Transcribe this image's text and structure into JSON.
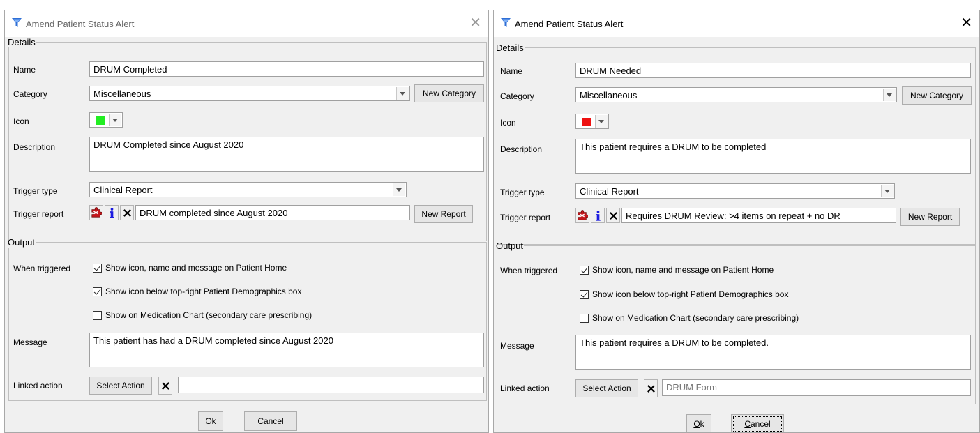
{
  "colors": {
    "left_icon": "#22ee22",
    "right_icon": "#ee1111",
    "info_icon": "#1a1ae0"
  },
  "icons": {
    "app": "filter-funnel-icon",
    "close": "close-icon",
    "trigger": "report-puzzle-icon",
    "info": "info-icon",
    "clear": "clear-x-icon"
  },
  "left": {
    "title": "Amend Patient Status Alert",
    "close": "✕",
    "details": {
      "legend": "Details",
      "name_label": "Name",
      "name_value": "DRUM Completed",
      "category_label": "Category",
      "category_value": "Miscellaneous",
      "new_category": "New Category",
      "icon_label": "Icon",
      "description_label": "Description",
      "description_value": "DRUM Completed since August 2020",
      "trigger_type_label": "Trigger type",
      "trigger_type_value": "Clinical Report",
      "trigger_report_label": "Trigger report",
      "trigger_report_value": "DRUM completed since August 2020",
      "new_report": "New Report"
    },
    "output": {
      "legend": "Output",
      "when_triggered_label": "When triggered",
      "checks": [
        {
          "label": "Show icon, name and message on Patient Home",
          "checked": true
        },
        {
          "label": "Show icon below top-right Patient Demographics box",
          "checked": true
        },
        {
          "label": "Show on Medication Chart (secondary care prescribing)",
          "checked": false
        }
      ],
      "message_label": "Message",
      "message_value": "This patient has had a DRUM completed since August 2020",
      "linked_action_label": "Linked action",
      "select_action": "Select Action",
      "linked_action_value": ""
    },
    "ok_mnem": "O",
    "ok_rest": "k",
    "cancel_mnem": "C",
    "cancel_rest": "ancel"
  },
  "right": {
    "title": "Amend Patient Status Alert",
    "close": "✕",
    "details": {
      "legend": "Details",
      "name_label": "Name",
      "name_value": "DRUM Needed",
      "category_label": "Category",
      "category_value": "Miscellaneous",
      "new_category": "New Category",
      "icon_label": "Icon",
      "description_label": "Description",
      "description_value": "This patient requires a DRUM to be completed",
      "trigger_type_label": "Trigger type",
      "trigger_type_value": "Clinical Report",
      "trigger_report_label": "Trigger report",
      "trigger_report_value": "Requires DRUM Review: >4 items on repeat + no DR",
      "new_report": "New Report"
    },
    "output": {
      "legend": "Output",
      "when_triggered_label": "When triggered",
      "checks": [
        {
          "label": "Show icon, name and message on Patient Home",
          "checked": true
        },
        {
          "label": "Show icon below top-right Patient Demographics box",
          "checked": true
        },
        {
          "label": "Show on Medication Chart (secondary care prescribing)",
          "checked": false
        }
      ],
      "message_label": "Message",
      "message_value": "This patient requires a DRUM to be completed.",
      "linked_action_label": "Linked action",
      "select_action": "Select Action",
      "linked_action_value": "DRUM Form"
    },
    "ok_mnem": "O",
    "ok_rest": "k",
    "cancel_mnem": "C",
    "cancel_rest": "ancel"
  }
}
